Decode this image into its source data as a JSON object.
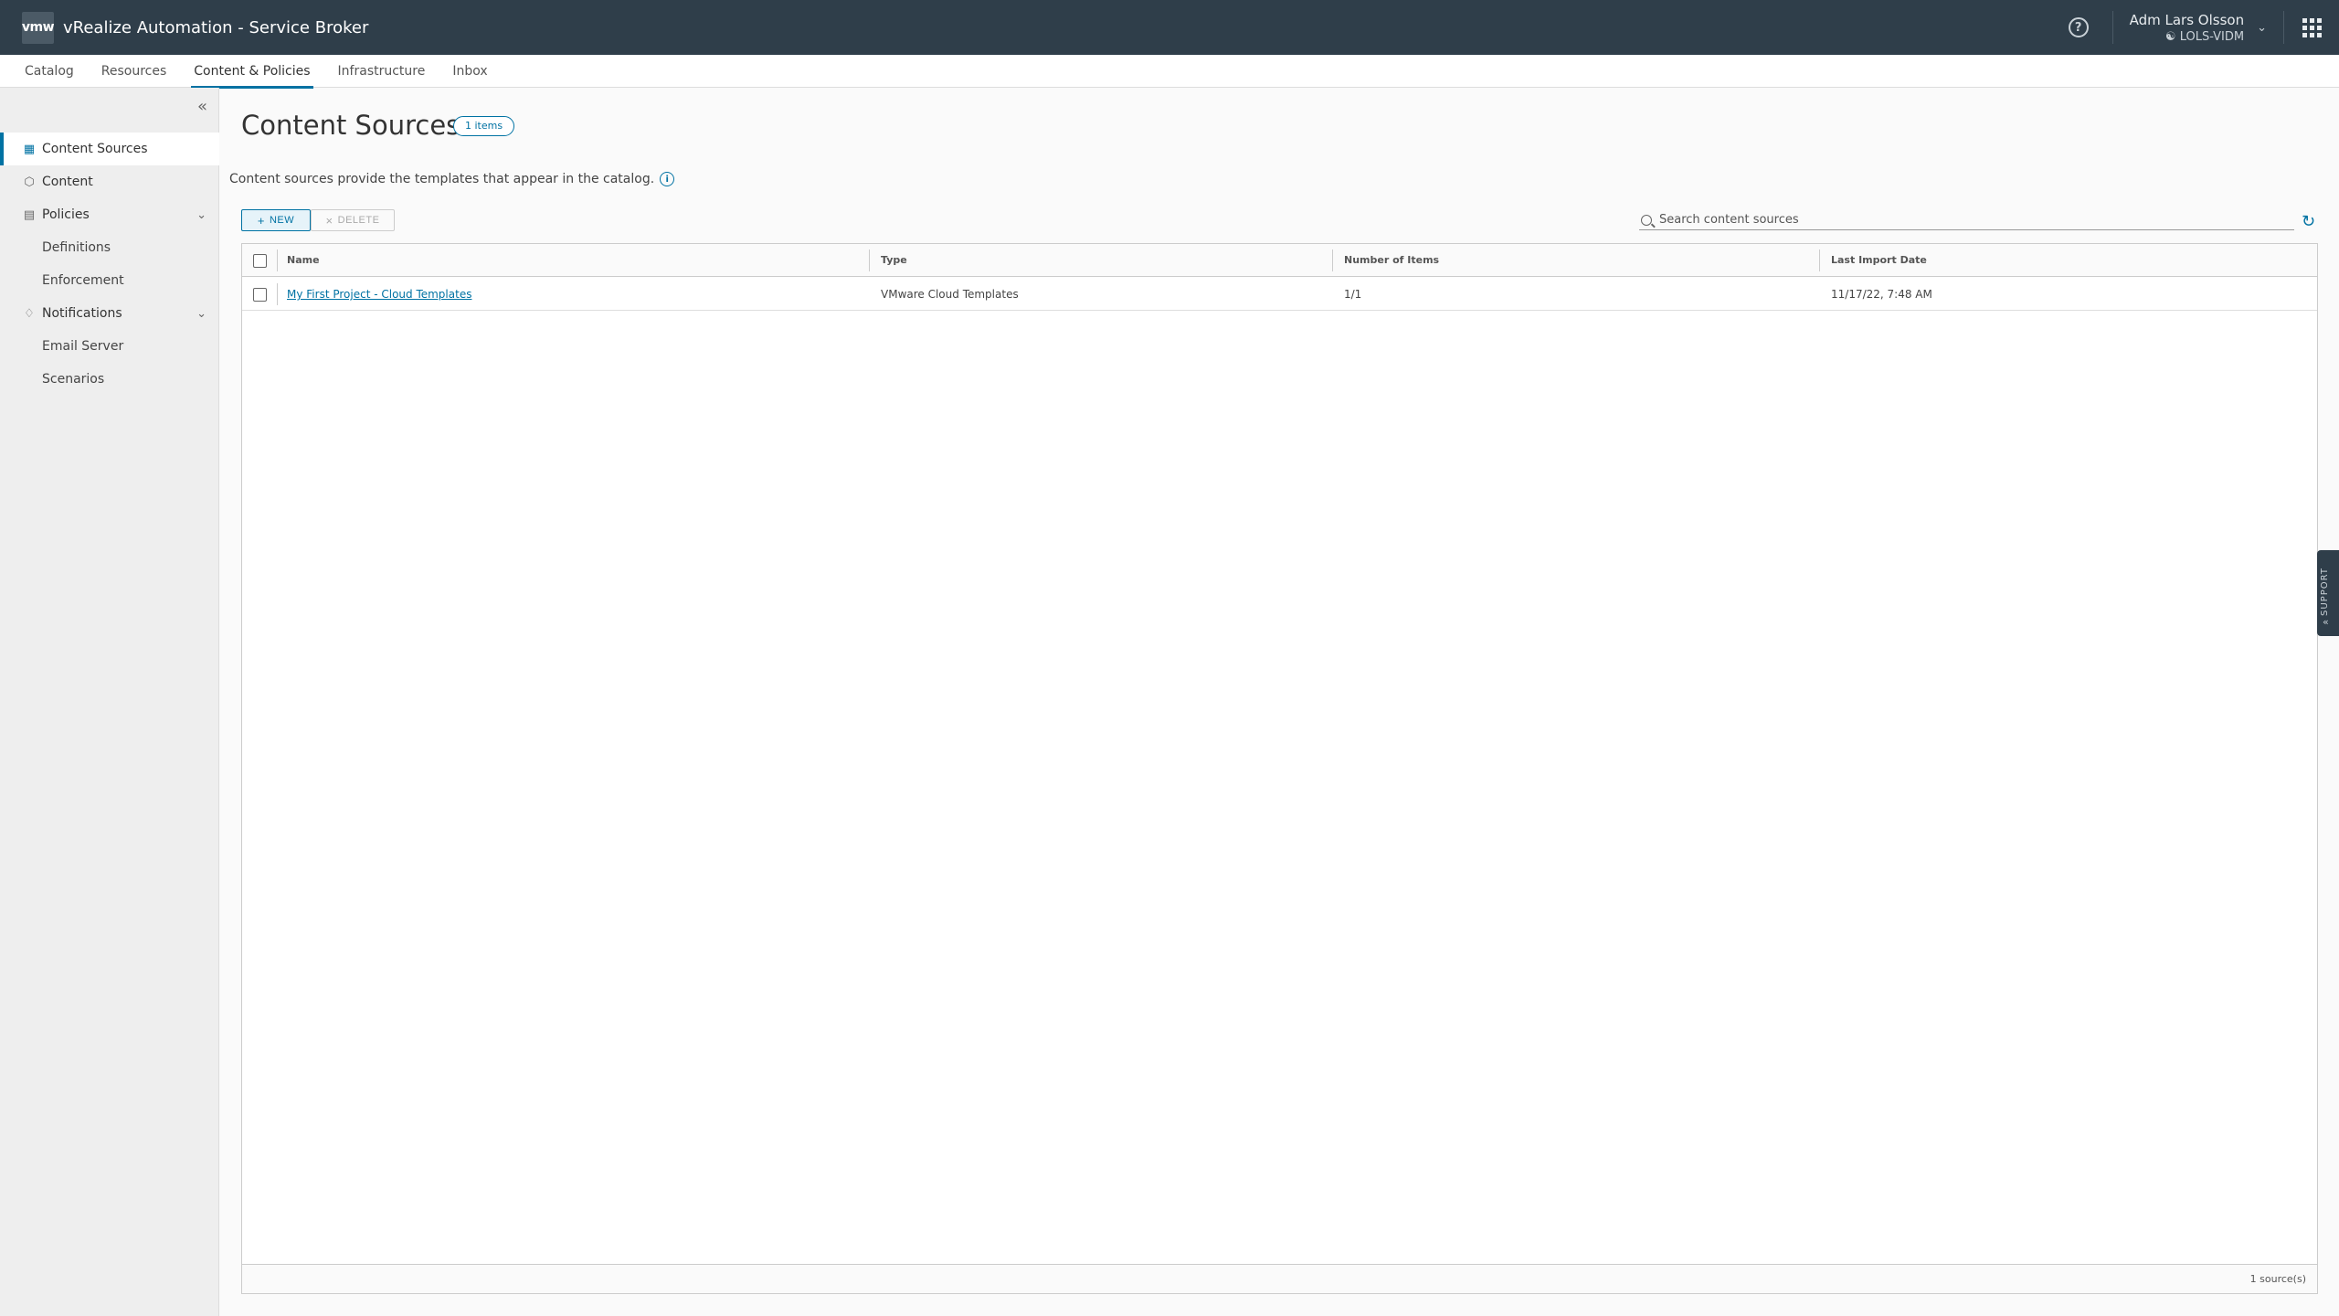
{
  "header": {
    "logo_text": "vmw",
    "app_title": "vRealize Automation - Service Broker",
    "help_glyph": "?",
    "user_name": "Adm Lars Olsson",
    "tenant": "LOLS-VIDM"
  },
  "tabs": [
    {
      "label": "Catalog"
    },
    {
      "label": "Resources"
    },
    {
      "label": "Content & Policies"
    },
    {
      "label": "Infrastructure"
    },
    {
      "label": "Inbox"
    }
  ],
  "sidebar": {
    "items": [
      {
        "label": "Content Sources",
        "icon": "content-sources-icon"
      },
      {
        "label": "Content",
        "icon": "cube-icon"
      },
      {
        "label": "Policies",
        "icon": "policies-icon"
      },
      {
        "label": "Definitions"
      },
      {
        "label": "Enforcement"
      },
      {
        "label": "Notifications",
        "icon": "bell-icon"
      },
      {
        "label": "Email Server"
      },
      {
        "label": "Scenarios"
      }
    ]
  },
  "main": {
    "title": "Content Sources",
    "badge": "1 items",
    "description": "Content sources provide the templates that appear in the catalog.",
    "new_label": "NEW",
    "delete_label": "DELETE",
    "search_placeholder": "Search content sources",
    "columns": [
      "Name",
      "Type",
      "Number of Items",
      "Last Import Date"
    ],
    "rows": [
      {
        "name": "My First Project - Cloud Templates",
        "type": "VMware Cloud Templates",
        "items": "1/1",
        "date": "11/17/22, 7:48 AM"
      }
    ],
    "footer": "1 source(s)"
  },
  "support": {
    "label": "SUPPORT"
  },
  "colors": {
    "header_bg": "#2f3e4a",
    "accent": "#0072a3"
  }
}
